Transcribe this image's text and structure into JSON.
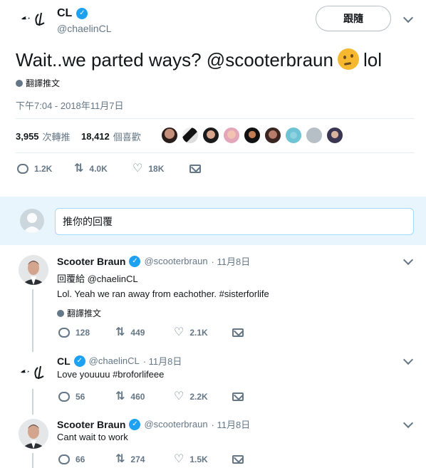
{
  "main_tweet": {
    "logo_text": "𝓛",
    "author_name": "CL",
    "author_handle": "@chaelinCL",
    "follow_label": "跟隨",
    "text_before": "Wait..we parted ways? @scooterbraun",
    "text_after": "lol",
    "emoji": "thinking-face",
    "translate_label": "翻譯推文",
    "timestamp": "下午7:04 - 2018年11月7日",
    "retweets_count": "3,955",
    "retweets_label": "次轉推",
    "likes_count": "18,412",
    "likes_label": "個喜歡",
    "actions": {
      "replies": "1.2K",
      "retweets": "4.0K",
      "likes": "18K"
    }
  },
  "reply_box": {
    "placeholder": "推你的回覆"
  },
  "thread": [
    {
      "name": "Scooter Braun",
      "handle": "@scooterbraun",
      "date": "· 11月8日",
      "reply_to": "回覆給 @chaelinCL",
      "text": "Lol. Yeah we ran away from eachother. #sisterforlife",
      "translate_label": "翻譯推文",
      "replies": "128",
      "retweets": "449",
      "likes": "2.1K"
    },
    {
      "name": "CL",
      "handle": "@chaelinCL",
      "date": "· 11月8日",
      "text": "Love youuuu #broforlifeee",
      "replies": "56",
      "retweets": "460",
      "likes": "2.2K"
    },
    {
      "name": "Scooter Braun",
      "handle": "@scooterbraun",
      "date": "· 11月8日",
      "text": "Cant wait to work",
      "replies": "66",
      "retweets": "274",
      "likes": "1.5K"
    }
  ],
  "colors": {
    "accent": "#1da1f2",
    "muted": "#657786",
    "reply_band": "#e8f5fd"
  }
}
